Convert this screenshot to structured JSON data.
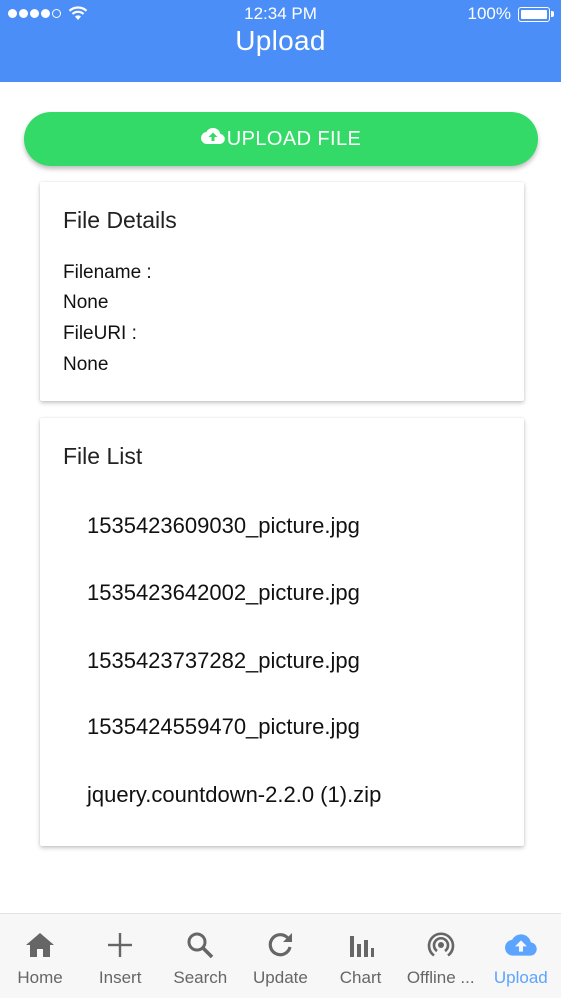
{
  "status_bar": {
    "time": "12:34 PM",
    "battery": "100%"
  },
  "header": {
    "title": "Upload"
  },
  "upload_button": {
    "label": "UPLOAD FILE",
    "icon": "cloud-upload-icon"
  },
  "file_details": {
    "title": "File Details",
    "filename_label": "Filename :",
    "filename_value": "None",
    "fileuri_label": "FileURI :",
    "fileuri_value": "None"
  },
  "file_list": {
    "title": "File List",
    "items": [
      "1535423609030_picture.jpg",
      "1535423642002_picture.jpg",
      "1535423737282_picture.jpg",
      "1535424559470_picture.jpg",
      "jquery.countdown-2.2.0 (1).zip"
    ]
  },
  "tabs": [
    {
      "label": "Home",
      "icon": "home-icon"
    },
    {
      "label": "Insert",
      "icon": "plus-icon"
    },
    {
      "label": "Search",
      "icon": "search-icon"
    },
    {
      "label": "Update",
      "icon": "refresh-icon"
    },
    {
      "label": "Chart",
      "icon": "bar-chart-icon"
    },
    {
      "label": "Offline ...",
      "icon": "broadcast-icon"
    },
    {
      "label": "Upload",
      "icon": "cloud-upload-icon",
      "active": true
    }
  ],
  "colors": {
    "header": "#4b8ef7",
    "upload_button": "#34da68",
    "active_tab": "#5ba4ff",
    "inactive_tab": "#666666"
  }
}
